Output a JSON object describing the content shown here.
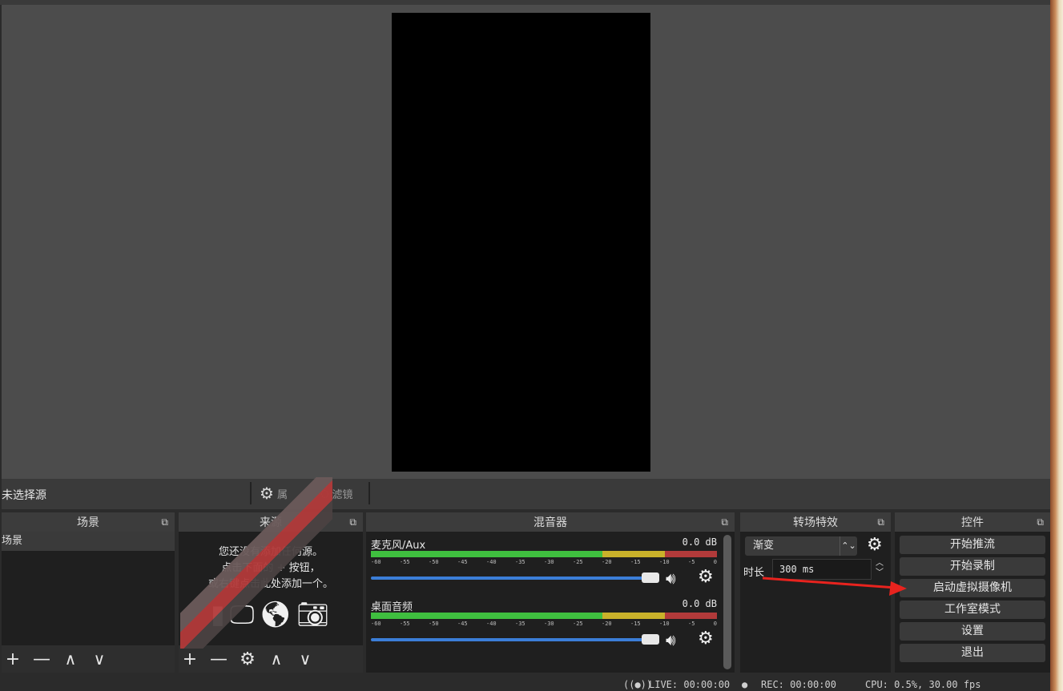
{
  "source_toolbar": {
    "no_source": "未选择源",
    "properties": "属",
    "filters": "滤镜"
  },
  "scenes": {
    "title": "场景",
    "items": [
      "场景"
    ]
  },
  "sources": {
    "title": "来源",
    "empty_line1": "您还没有添加任何源。",
    "empty_line2": "点击下面的 + 按钮，",
    "empty_line3": "或右键点击此处添加一个。"
  },
  "mixer": {
    "title": "混音器",
    "tracks": [
      {
        "name": "麦克风/Aux",
        "db": "0.0 dB"
      },
      {
        "name": "桌面音频",
        "db": "0.0 dB"
      }
    ],
    "ticks": [
      "-60",
      "-55",
      "-50",
      "-45",
      "-40",
      "-35",
      "-30",
      "-25",
      "-20",
      "-15",
      "-10",
      "-5",
      "0"
    ]
  },
  "transitions": {
    "title": "转场特效",
    "selected": "渐变",
    "duration_label": "时长",
    "duration_value": "300 ms"
  },
  "controls": {
    "title": "控件",
    "buttons": [
      "开始推流",
      "开始录制",
      "启动虚拟摄像机",
      "工作室模式",
      "设置",
      "退出"
    ]
  },
  "status": {
    "live": "LIVE: 00:00:00",
    "rec": "REC: 00:00:00",
    "cpu": "CPU: 0.5%, 30.00 fps"
  },
  "colors": {
    "annotation_arrow": "#e8231e",
    "meter_green": "#3fbf3f",
    "meter_yellow": "#c9b12a",
    "meter_red": "#b23a3a",
    "fader_blue": "#3b7ed8"
  }
}
